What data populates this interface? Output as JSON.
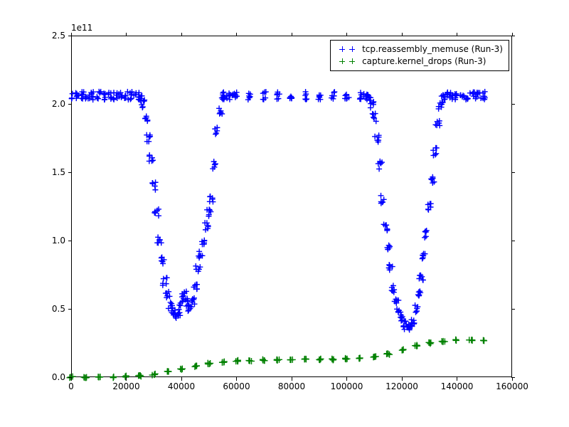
{
  "chart_data": {
    "type": "scatter",
    "title": "",
    "xlabel": "",
    "ylabel": "",
    "offset_text": "1e11",
    "xlim": [
      0,
      160000
    ],
    "ylim": [
      0,
      250000000000.0
    ],
    "xticks": [
      0,
      20000,
      40000,
      60000,
      80000,
      100000,
      120000,
      140000,
      160000
    ],
    "yticks": [
      0.0,
      50000000000.0,
      100000000000.0,
      150000000000.0,
      200000000000.0,
      250000000000.0
    ],
    "ytick_labels": [
      "0.0",
      "0.5",
      "1.0",
      "1.5",
      "2.0",
      "2.5"
    ],
    "legend": {
      "position": "upper right",
      "entries": [
        {
          "label": "tcp.reassembly_memuse (Run-3)",
          "color": "#0000ff",
          "marker": "+"
        },
        {
          "label": "capture.kernel_drops (Run-3)",
          "color": "#008000",
          "marker": "+"
        }
      ]
    },
    "series": [
      {
        "name": "tcp.reassembly_memuse (Run-3)",
        "color": "#0000ff",
        "marker": "+",
        "points": [
          [
            0,
            206000000000.0
          ],
          [
            2000,
            206000000000.0
          ],
          [
            4000,
            206000000000.0
          ],
          [
            6000,
            206000000000.0
          ],
          [
            8000,
            206000000000.0
          ],
          [
            10000,
            206000000000.0
          ],
          [
            12000,
            206000000000.0
          ],
          [
            14000,
            206000000000.0
          ],
          [
            16000,
            206000000000.0
          ],
          [
            18000,
            206000000000.0
          ],
          [
            20000,
            206000000000.0
          ],
          [
            22000,
            206000000000.0
          ],
          [
            24000,
            206000000000.0
          ],
          [
            25000,
            205000000000.0
          ],
          [
            26000,
            200000000000.0
          ],
          [
            27000,
            190000000000.0
          ],
          [
            28000,
            175000000000.0
          ],
          [
            29000,
            160000000000.0
          ],
          [
            30000,
            140000000000.0
          ],
          [
            31000,
            120000000000.0
          ],
          [
            32000,
            100000000000.0
          ],
          [
            33000,
            85000000000.0
          ],
          [
            34000,
            70000000000.0
          ],
          [
            35000,
            60000000000.0
          ],
          [
            36000,
            52000000000.0
          ],
          [
            37000,
            48000000000.0
          ],
          [
            38000,
            45000000000.0
          ],
          [
            39000,
            48000000000.0
          ],
          [
            40000,
            55000000000.0
          ],
          [
            41000,
            60000000000.0
          ],
          [
            42000,
            55000000000.0
          ],
          [
            43000,
            50000000000.0
          ],
          [
            44000,
            55000000000.0
          ],
          [
            45000,
            65000000000.0
          ],
          [
            46000,
            80000000000.0
          ],
          [
            47000,
            90000000000.0
          ],
          [
            48000,
            100000000000.0
          ],
          [
            49000,
            110000000000.0
          ],
          [
            50000,
            120000000000.0
          ],
          [
            51000,
            130000000000.0
          ],
          [
            52000,
            155000000000.0
          ],
          [
            53000,
            180000000000.0
          ],
          [
            54000,
            195000000000.0
          ],
          [
            55000,
            205000000000.0
          ],
          [
            56000,
            206000000000.0
          ],
          [
            58000,
            206000000000.0
          ],
          [
            60000,
            206000000000.0
          ],
          [
            65000,
            206000000000.0
          ],
          [
            70000,
            206000000000.0
          ],
          [
            75000,
            206000000000.0
          ],
          [
            80000,
            206000000000.0
          ],
          [
            85000,
            206000000000.0
          ],
          [
            90000,
            206000000000.0
          ],
          [
            95000,
            206000000000.0
          ],
          [
            100000,
            206000000000.0
          ],
          [
            105000,
            206000000000.0
          ],
          [
            107000,
            206000000000.0
          ],
          [
            108000,
            205000000000.0
          ],
          [
            109000,
            200000000000.0
          ],
          [
            110000,
            190000000000.0
          ],
          [
            111000,
            175000000000.0
          ],
          [
            112000,
            155000000000.0
          ],
          [
            113000,
            130000000000.0
          ],
          [
            114000,
            110000000000.0
          ],
          [
            115000,
            95000000000.0
          ],
          [
            116000,
            80000000000.0
          ],
          [
            117000,
            65000000000.0
          ],
          [
            118000,
            55000000000.0
          ],
          [
            119000,
            48000000000.0
          ],
          [
            120000,
            42000000000.0
          ],
          [
            121000,
            38000000000.0
          ],
          [
            122000,
            36000000000.0
          ],
          [
            123000,
            38000000000.0
          ],
          [
            124000,
            42000000000.0
          ],
          [
            125000,
            50000000000.0
          ],
          [
            126000,
            60000000000.0
          ],
          [
            127000,
            72000000000.0
          ],
          [
            128000,
            88000000000.0
          ],
          [
            129000,
            105000000000.0
          ],
          [
            130000,
            125000000000.0
          ],
          [
            131000,
            145000000000.0
          ],
          [
            132000,
            165000000000.0
          ],
          [
            133000,
            185000000000.0
          ],
          [
            134000,
            198000000000.0
          ],
          [
            135000,
            204000000000.0
          ],
          [
            136000,
            206000000000.0
          ],
          [
            138000,
            206000000000.0
          ],
          [
            140000,
            206000000000.0
          ],
          [
            142000,
            206000000000.0
          ],
          [
            144000,
            206000000000.0
          ],
          [
            146000,
            206000000000.0
          ],
          [
            148000,
            206000000000.0
          ],
          [
            150000,
            206000000000.0
          ]
        ]
      },
      {
        "name": "capture.kernel_drops (Run-3)",
        "color": "#008000",
        "marker": "+",
        "points": [
          [
            0,
            0.0
          ],
          [
            5000,
            0.0
          ],
          [
            10000,
            0.0
          ],
          [
            15000,
            0.0
          ],
          [
            20000,
            500000000.0
          ],
          [
            25000,
            1000000000.0
          ],
          [
            30000,
            2000000000.0
          ],
          [
            35000,
            4000000000.0
          ],
          [
            40000,
            6000000000.0
          ],
          [
            45000,
            8000000000.0
          ],
          [
            50000,
            10000000000.0
          ],
          [
            55000,
            11000000000.0
          ],
          [
            60000,
            12000000000.0
          ],
          [
            65000,
            12000000000.0
          ],
          [
            70000,
            12500000000.0
          ],
          [
            75000,
            12500000000.0
          ],
          [
            80000,
            13000000000.0
          ],
          [
            85000,
            13000000000.0
          ],
          [
            90000,
            13000000000.0
          ],
          [
            95000,
            13000000000.0
          ],
          [
            100000,
            13500000000.0
          ],
          [
            105000,
            14000000000.0
          ],
          [
            110000,
            15000000000.0
          ],
          [
            115000,
            17000000000.0
          ],
          [
            120000,
            20000000000.0
          ],
          [
            125000,
            23000000000.0
          ],
          [
            130000,
            25000000000.0
          ],
          [
            135000,
            26000000000.0
          ],
          [
            140000,
            27000000000.0
          ],
          [
            145000,
            27000000000.0
          ],
          [
            150000,
            27000000000.0
          ]
        ]
      }
    ]
  }
}
